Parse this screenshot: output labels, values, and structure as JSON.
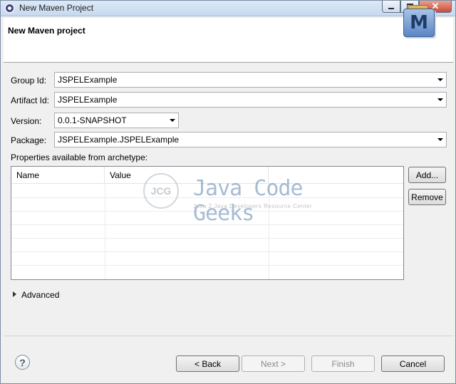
{
  "window": {
    "title": "New Maven Project"
  },
  "banner": {
    "title": "New Maven project",
    "logo_letter": "M"
  },
  "form": {
    "group_id": {
      "label": "Group Id:",
      "value": "JSPELExample"
    },
    "artifact_id": {
      "label": "Artifact Id:",
      "value": "JSPELExample"
    },
    "version": {
      "label": "Version:",
      "value": "0.0.1-SNAPSHOT"
    },
    "package": {
      "label": "Package:",
      "value": "JSPELExample.JSPELExample"
    }
  },
  "properties": {
    "label": "Properties available from archetype:",
    "columns": [
      "Name",
      "Value"
    ],
    "add_button": "Add...",
    "remove_button": "Remove"
  },
  "watermark": {
    "badge": "JCG",
    "name": "Java Code Geeks",
    "tagline": "Java 2 Java Developers Resource Center"
  },
  "advanced": {
    "label": "Advanced"
  },
  "buttons": {
    "back": "< Back",
    "next": "Next >",
    "finish": "Finish",
    "cancel": "Cancel"
  },
  "icons": {
    "help": "?"
  }
}
